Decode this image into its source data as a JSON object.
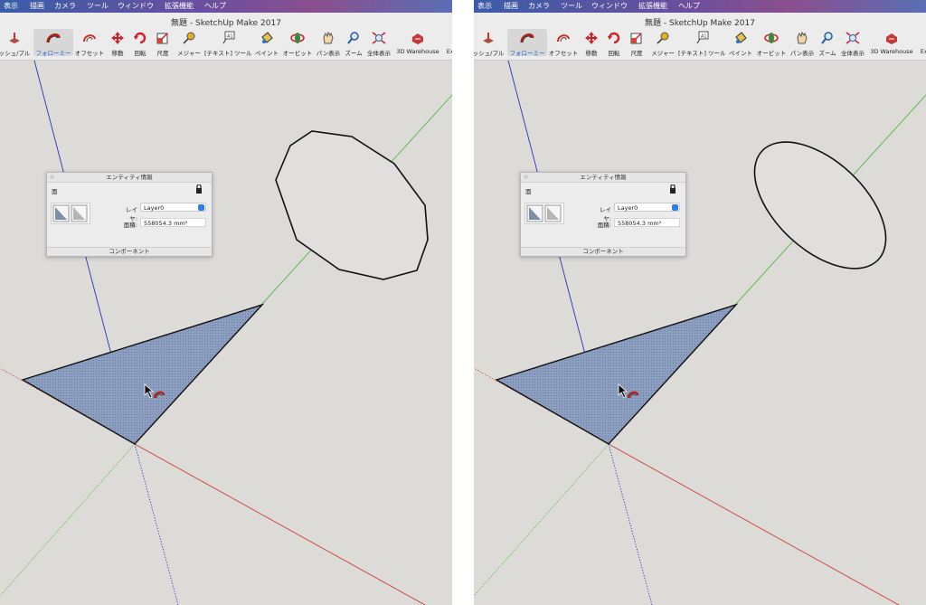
{
  "app": {
    "window_title": "無題 - SketchUp Make 2017"
  },
  "menubar": {
    "items": [
      "表示",
      "描画",
      "カメラ",
      "ツール",
      "ウィンドウ",
      "拡張機能",
      "ヘルプ"
    ]
  },
  "toolbar": {
    "tools": [
      {
        "label": "ッシュ/プル",
        "icon": "push-pull-icon"
      },
      {
        "label": "フォローミー",
        "icon": "follow-me-icon",
        "active": true
      },
      {
        "label": "オフセット",
        "icon": "offset-icon"
      },
      {
        "label": "移動",
        "icon": "move-icon"
      },
      {
        "label": "回転",
        "icon": "rotate-icon"
      },
      {
        "label": "尺度",
        "icon": "scale-icon"
      },
      {
        "label": "メジャー",
        "icon": "tape-measure-icon"
      },
      {
        "label": "[テキスト] ツール",
        "icon": "text-tool-icon"
      },
      {
        "label": "ペイント",
        "icon": "paint-bucket-icon"
      },
      {
        "label": "オービット",
        "icon": "orbit-icon"
      },
      {
        "label": "パン表示",
        "icon": "pan-icon"
      },
      {
        "label": "ズーム",
        "icon": "zoom-icon"
      },
      {
        "label": "全体表示",
        "icon": "zoom-extents-icon"
      },
      {
        "label": "3D Warehouse",
        "icon": "3d-warehouse-icon"
      },
      {
        "label": "Ext",
        "icon": "extension-warehouse-icon"
      }
    ]
  },
  "entity_info": {
    "title": "エンティティ情報",
    "entity_type": "面",
    "layer_label": "レイヤ:",
    "layer_value": "Layer0",
    "area_label": "面積:",
    "area_value": "558054.3 mm²",
    "footer": "コンポーネント"
  },
  "colors": {
    "face_fill": "#8d9fc0",
    "canvas_bg": "#dddbd8",
    "axis_blue": "#2b2fbf",
    "axis_green": "#4dbb3b",
    "axis_red": "#c83a3a",
    "active_tool_label": "#1f5fd6"
  }
}
